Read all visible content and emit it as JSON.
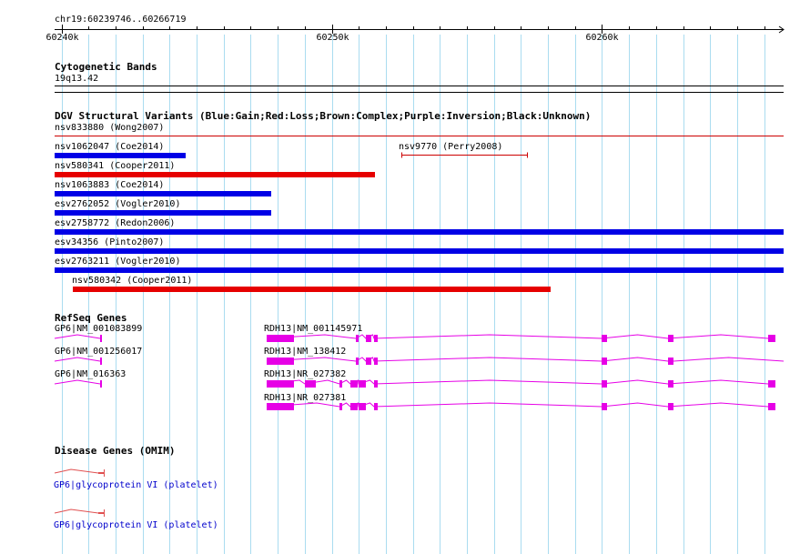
{
  "window": {
    "width": 890,
    "height": 609
  },
  "ruler": {
    "location": "chr19:60239746..60266719",
    "start": 60239746,
    "end": 60266719,
    "tick_labels": [
      {
        "pos": 60240000,
        "label": "60240k"
      },
      {
        "pos": 60250000,
        "label": "60250k"
      },
      {
        "pos": 60260000,
        "label": "60260k"
      }
    ]
  },
  "cytoband": {
    "title": "Cytogenetic Bands",
    "band": "19q13.42"
  },
  "dgv": {
    "title": "DGV Structural Variants (Blue:Gain;Red:Loss;Brown:Complex;Purple:Inversion;Black:Unknown)",
    "colors": {
      "gain": "#0000e6",
      "loss": "#e60000",
      "thin_loss": "#cc0000"
    },
    "variants": [
      {
        "label": "nsv833880 (Wong2007)",
        "start": 60239746,
        "end": 60266719,
        "kind": "loss",
        "style": "thin"
      },
      {
        "label": "nsv1062047 (Coe2014)",
        "start": 60239746,
        "end": 60244600,
        "kind": "gain",
        "style": "bar"
      },
      {
        "label": "nsv9770 (Perry2008)",
        "start": 60252570,
        "end": 60257250,
        "kind": "loss",
        "style": "range"
      },
      {
        "label": "nsv580341 (Cooper2011)",
        "start": 60239746,
        "end": 60251600,
        "kind": "loss",
        "style": "bar"
      },
      {
        "label": "nsv1063883 (Coe2014)",
        "start": 60239746,
        "end": 60247750,
        "kind": "gain",
        "style": "bar"
      },
      {
        "label": "esv2762052 (Vogler2010)",
        "start": 60239746,
        "end": 60247750,
        "kind": "gain",
        "style": "bar"
      },
      {
        "label": "esv2758772 (Redon2006)",
        "start": 60239746,
        "end": 60266719,
        "kind": "gain",
        "style": "bar"
      },
      {
        "label": "esv34356 (Pinto2007)",
        "start": 60239746,
        "end": 60266719,
        "kind": "gain",
        "style": "bar"
      },
      {
        "label": "esv2763211 (Vogler2010)",
        "start": 60239746,
        "end": 60266719,
        "kind": "gain",
        "style": "bar"
      },
      {
        "label": "nsv580342 (Cooper2011)",
        "start": 60240420,
        "end": 60258110,
        "kind": "loss",
        "style": "bar"
      }
    ]
  },
  "refseq": {
    "title": "RefSeq Genes",
    "color": "#e600e6",
    "genes": [
      {
        "label": "GP6|NM_001083899",
        "start": 60239746,
        "end": 60241500,
        "exons": [
          [
            60241430,
            60241500
          ]
        ]
      },
      {
        "label": "GP6|NM_001256017",
        "start": 60239746,
        "end": 60241500,
        "exons": [
          [
            60241430,
            60241500
          ]
        ]
      },
      {
        "label": "GP6|NM_016363",
        "start": 60239746,
        "end": 60241500,
        "exons": [
          [
            60241430,
            60241500
          ]
        ]
      },
      {
        "label": "RDH13|NM_001145971",
        "start": 60247600,
        "end": 60266400,
        "exons": [
          [
            60247600,
            60248600
          ],
          [
            60250900,
            60251000
          ],
          [
            60251250,
            60251450
          ],
          [
            60251550,
            60251700
          ],
          [
            60260000,
            60260200
          ],
          [
            60262450,
            60262650
          ],
          [
            60266150,
            60266400
          ]
        ]
      },
      {
        "label": "RDH13|NM_138412",
        "start": 60247600,
        "end": 60266719,
        "exons": [
          [
            60247600,
            60248600
          ],
          [
            60250900,
            60251000
          ],
          [
            60251250,
            60251450
          ],
          [
            60251550,
            60251700
          ],
          [
            60260000,
            60260200
          ],
          [
            60262450,
            60262650
          ]
        ]
      },
      {
        "label": "RDH13|NR_027382",
        "start": 60247600,
        "end": 60266400,
        "exons": [
          [
            60247600,
            60248600
          ],
          [
            60249000,
            60249400
          ],
          [
            60250300,
            60250400
          ],
          [
            60250700,
            60250950
          ],
          [
            60251000,
            60251250
          ],
          [
            60251550,
            60251700
          ],
          [
            60260000,
            60260200
          ],
          [
            60262450,
            60262650
          ],
          [
            60266150,
            60266400
          ]
        ]
      },
      {
        "label": "RDH13|NR_027381",
        "start": 60247600,
        "end": 60266400,
        "exons": [
          [
            60247600,
            60248600
          ],
          [
            60250300,
            60250400
          ],
          [
            60250700,
            60250950
          ],
          [
            60251000,
            60251250
          ],
          [
            60251550,
            60251700
          ],
          [
            60260000,
            60260200
          ],
          [
            60262450,
            60262650
          ],
          [
            60266150,
            60266400
          ]
        ]
      }
    ]
  },
  "omim": {
    "title": "Disease Genes (OMIM)",
    "color": "#e05050",
    "text_color": "#0000cc",
    "entries": [
      {
        "label": "GP6|glycoprotein VI (platelet)",
        "start": 60239746,
        "end": 60241500
      },
      {
        "label": "GP6|glycoprotein VI (platelet)",
        "start": 60239746,
        "end": 60241500
      }
    ]
  }
}
